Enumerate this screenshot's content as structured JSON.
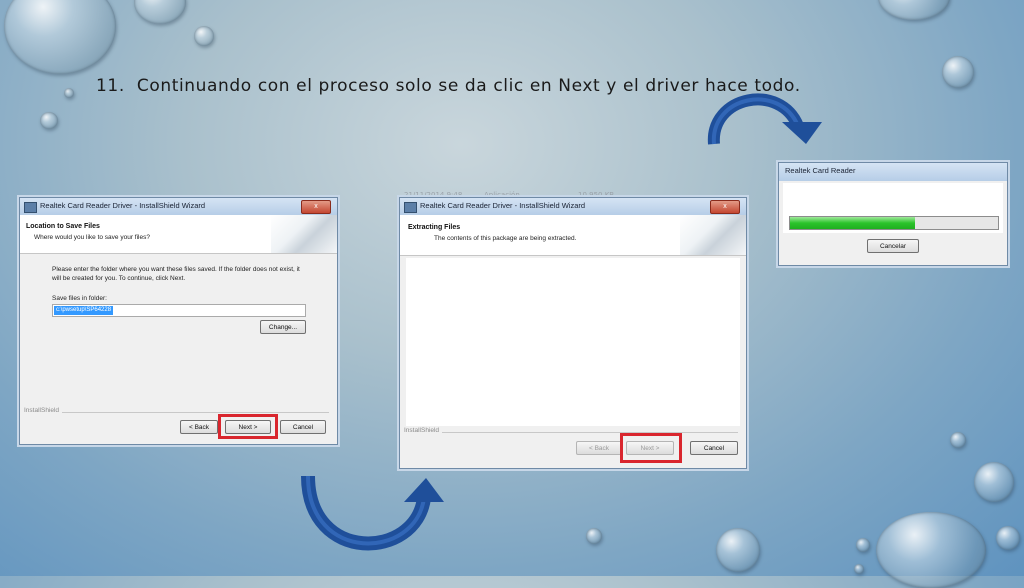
{
  "caption": {
    "number": "11.",
    "text": "Continuando con el proceso solo se da clic en Next y el driver hace todo."
  },
  "win1": {
    "title": "Realtek Card Reader Driver - InstallShield Wizard",
    "close": "x",
    "heading": "Location to Save Files",
    "subheading": "Where would you like to save your files?",
    "body": "Please enter the folder where you want these files saved.  If the folder does not exist, it will be created for you.   To continue, click Next.",
    "field_label": "Save files in folder:",
    "field_value": "c:\\pwsetup\\SP64228",
    "change_button": "Change...",
    "group_label": "InstallShield",
    "back_button": "< Back",
    "next_button": "Next >",
    "cancel_button": "Cancel"
  },
  "win2": {
    "ghost_date": "21/11/2014 9:48",
    "ghost_type": "Aplicación",
    "ghost_size": "10.950 KB",
    "title": "Realtek Card Reader Driver - InstallShield Wizard",
    "close": "x",
    "heading": "Extracting Files",
    "subheading": "The contents of this package are being extracted.",
    "group_label": "InstallShield",
    "back_button": "< Back",
    "next_button": "Next >",
    "cancel_button": "Cancel"
  },
  "win3": {
    "title": "Realtek Card Reader",
    "cancel_button": "Cancelar",
    "progress": 0.6
  },
  "colors": {
    "highlight": "#d9262e",
    "arrow": "#1f4f9a",
    "progress": "#2bc42b"
  }
}
